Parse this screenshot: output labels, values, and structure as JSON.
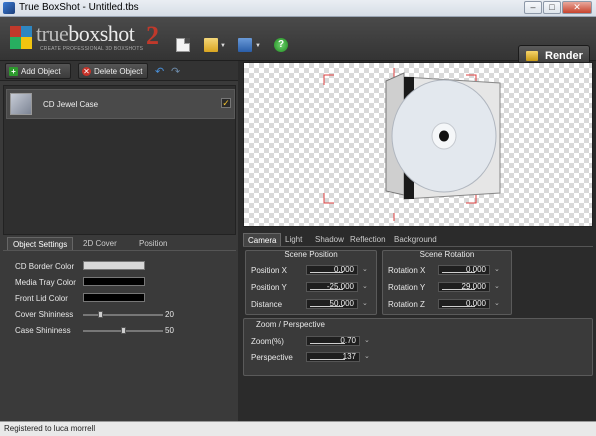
{
  "window": {
    "title": "True BoxShot - Untitled.tbs",
    "minimize": "–",
    "maximize": "□",
    "close": "✕"
  },
  "toolbar": {
    "logo_true": "true",
    "logo_box": "boxshot",
    "logo_num": "2",
    "logo_tagline": "CREATE PROFESSIONAL 3D BOXSHOTS",
    "help_glyph": "?",
    "render_label": "Render",
    "icons": [
      "new-document-icon",
      "open-folder-icon",
      "save-disk-icon",
      "help-icon",
      "render-icon"
    ]
  },
  "objects": {
    "add_label": "Add Object",
    "add_glyph": "+",
    "delete_label": "Delete Object",
    "delete_glyph": "✕",
    "undo_glyph": "↶",
    "redo_glyph": "↷",
    "items": [
      {
        "label": "CD Jewel Case",
        "checked": true,
        "check_glyph": "✓"
      }
    ]
  },
  "left_tabs": [
    "Object Settings",
    "2D Cover",
    "Position"
  ],
  "object_settings": {
    "cd_border_color_label": "CD Border Color",
    "cd_border_color": "#d8d8d8",
    "media_tray_color_label": "Media Tray Color",
    "media_tray_color": "#000000",
    "front_lid_color_label": "Front Lid Color",
    "front_lid_color": "#000000",
    "cover_shininess_label": "Cover Shininess",
    "cover_shininess": "20",
    "cover_shininess_level": 0.2,
    "case_shininess_label": "Case Shininess",
    "case_shininess": "50",
    "case_shininess_level": 0.5
  },
  "right_tabs": [
    "Camera",
    "Light",
    "Shadow",
    "Reflection",
    "Background"
  ],
  "camera": {
    "scene_position_title": "Scene Position",
    "position_x_label": "Position X",
    "position_x": "0.000",
    "position_y_label": "Position Y",
    "position_y": "-25.000",
    "distance_label": "Distance",
    "distance": "50.000",
    "scene_rotation_title": "Scene Rotation",
    "rotation_x_label": "Rotation X",
    "rotation_x": "0.000",
    "rotation_y_label": "Rotation Y",
    "rotation_y": "29.000",
    "rotation_z_label": "Rotation Z",
    "rotation_z": "0.000",
    "zoom_title": "Zoom / Perspective",
    "zoom_label": "Zoom(%)",
    "zoom": "0.70",
    "perspective_label": "Perspective",
    "perspective": "137",
    "spin_glyph": "⌄"
  },
  "status": {
    "text": "Registered to luca morrell"
  }
}
